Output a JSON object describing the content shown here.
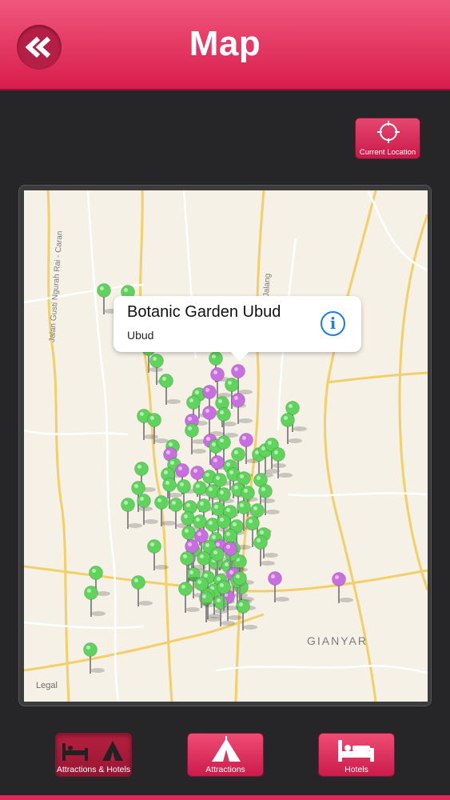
{
  "header": {
    "title": "Map",
    "back_icon": "double-chevron-left-icon"
  },
  "current_location": {
    "label": "Current Location",
    "icon": "crosshair-icon"
  },
  "map": {
    "callout": {
      "title": "Botanic Garden Ubud",
      "subtitle": "Ubud",
      "icon": "info-icon"
    },
    "street_labels": [
      "Jalan Gusti Ngurah Rai - Caran",
      "Jalan Jalang"
    ],
    "place_label": "GIANYAR",
    "legal_label": "Legal",
    "pin_colors": {
      "attraction": "#5ed45c",
      "hotel": "#c96ee0"
    }
  },
  "tabs": [
    {
      "label": "Attractions & Hotels",
      "icon": "bed-and-tent-icon",
      "active": true
    },
    {
      "label": "Attractions",
      "icon": "tent-icon",
      "active": false
    },
    {
      "label": "Hotels",
      "icon": "bed-icon",
      "active": false
    }
  ],
  "colors": {
    "accent": "#e0265a",
    "background": "#262628"
  }
}
